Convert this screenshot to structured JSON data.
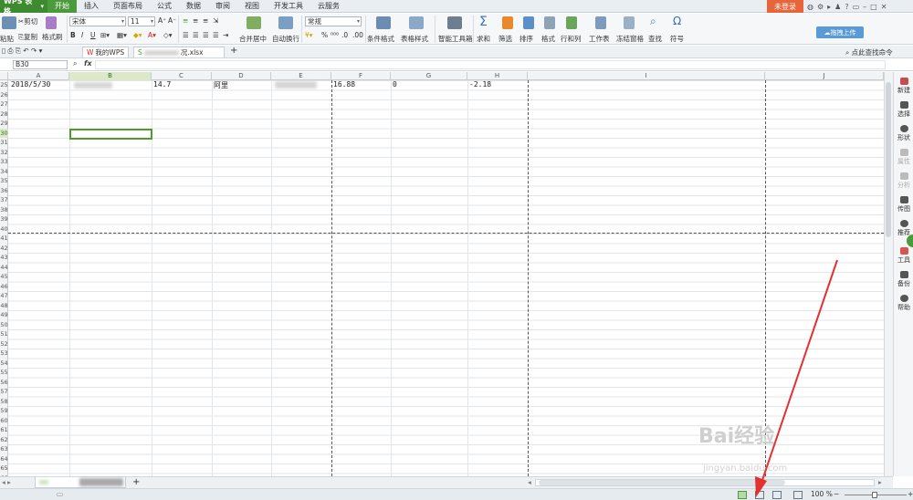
{
  "app": {
    "name": "WPS 表格"
  },
  "menu": {
    "tabs": [
      "开始",
      "插入",
      "页面布局",
      "公式",
      "数据",
      "审阅",
      "视图",
      "开发工具",
      "云服务"
    ],
    "active": "开始",
    "login": "未登录",
    "help": "?"
  },
  "ribbon": {
    "clipboard": {
      "paste": "粘贴",
      "cut": "剪切",
      "copy": "复制",
      "format_painter": "格式刷"
    },
    "font": {
      "name": "宋体",
      "size": "11",
      "bold": "B",
      "italic": "I",
      "underline": "U"
    },
    "alignment": {
      "merge": "合并居中",
      "wrap": "自动换行"
    },
    "number": {
      "format": "常规",
      "percent": "%"
    },
    "styles": {
      "conditional": "条件格式",
      "table_style": "表格样式"
    },
    "tools": {
      "smart": "智能工具箱",
      "sum": "求和",
      "filter": "筛选",
      "sort": "排序",
      "format": "格式",
      "rowcol": "行和列",
      "sheet": "工作表",
      "freeze": "冻结窗格",
      "find": "查找",
      "symbol": "符号"
    },
    "cloud_upload": "拖拽上传"
  },
  "tabbar": {
    "home_tab": "我的WPS",
    "file_tab": "况.xlsx",
    "add": "+",
    "search_hint": "点此查找命令"
  },
  "formula": {
    "name_box": "B30",
    "fx": "fx"
  },
  "columns": [
    "A",
    "B",
    "C",
    "D",
    "E",
    "F",
    "G",
    "H",
    "I",
    "J"
  ],
  "rows": [
    25,
    26,
    27,
    28,
    29,
    30,
    31,
    32,
    33,
    34,
    35,
    36,
    37,
    38,
    39,
    40,
    41,
    42,
    43,
    44,
    45,
    46,
    47,
    48,
    49,
    50,
    51,
    52,
    53,
    54,
    55,
    56,
    57,
    58,
    59,
    60,
    61,
    62,
    63,
    64,
    65,
    66,
    67
  ],
  "selected_cell": {
    "column": "B",
    "row": 30
  },
  "row25": {
    "a": "2018/5/30",
    "c": "14.7",
    "d": "阿里",
    "f": "16.88",
    "g": "0",
    "h": "-2.18"
  },
  "sidebar": [
    "新建",
    "选择",
    "形状",
    "属性",
    "分析",
    "传图",
    "推荐",
    "工具",
    "备份",
    "帮助"
  ],
  "statusbar": {
    "zoom": "100 %",
    "minus": "−",
    "plus": "+"
  },
  "watermark": {
    "brand": "Bai经验",
    "url": "jingyan.baidu.com"
  },
  "colors": {
    "accent": "#4b9a3c",
    "login": "#e8643a",
    "arrow": "#e53030",
    "cloud": "#5b9bd5"
  }
}
